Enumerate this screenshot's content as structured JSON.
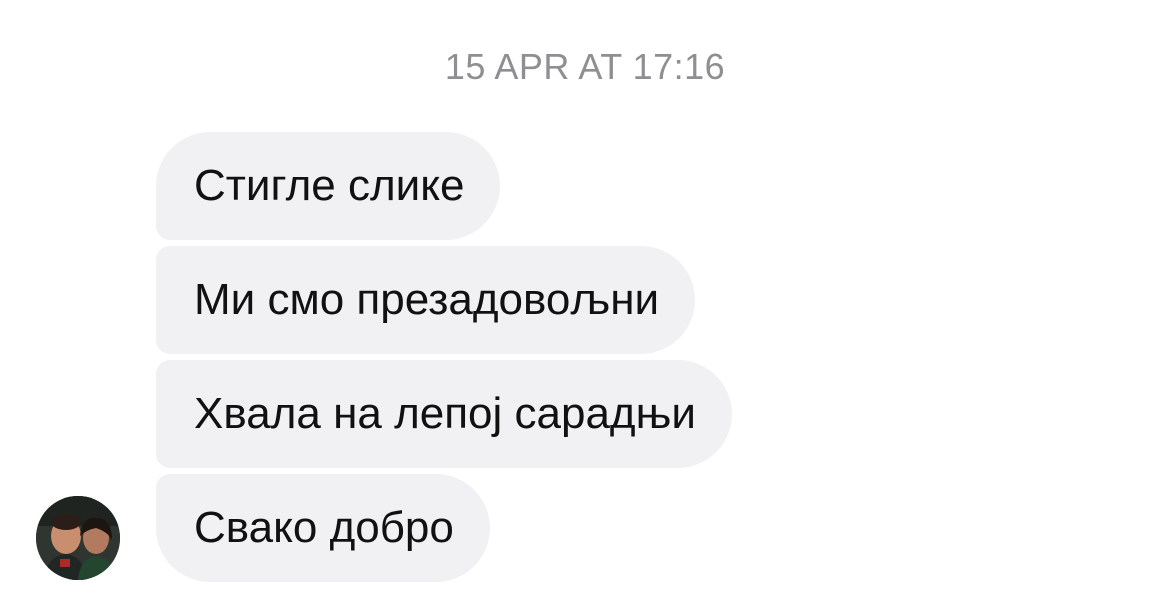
{
  "conversation": {
    "timestamp": "15 APR AT 17:16",
    "messages": [
      {
        "text": "Стигле слике"
      },
      {
        "text": "Ми смо презадовољни"
      },
      {
        "text": "Хвала на лепој сарадњи"
      },
      {
        "text": "Свако добро"
      }
    ],
    "sender_avatar_icon": "user-photo-avatar"
  },
  "colors": {
    "background": "#ffffff",
    "bubble_background": "#f1f1f4",
    "timestamp_text": "#8e8e93",
    "message_text": "#111111"
  }
}
